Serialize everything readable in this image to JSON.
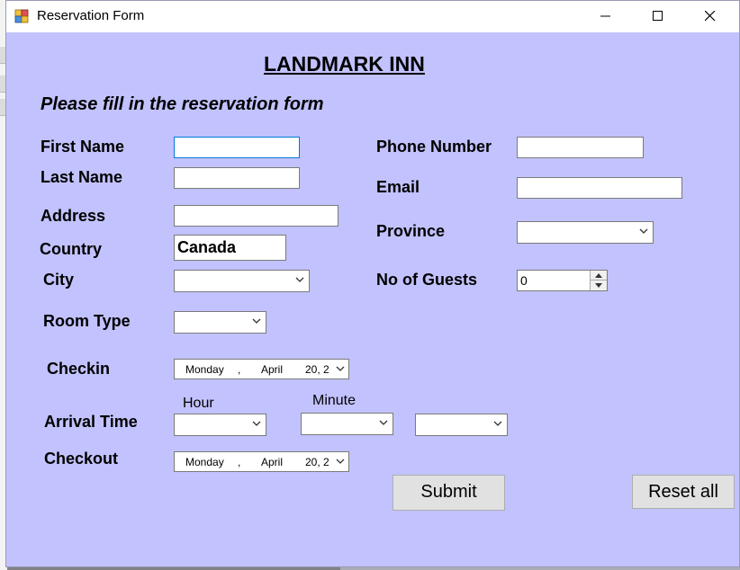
{
  "window": {
    "title": "Reservation Form"
  },
  "form": {
    "heading": "LANDMARK INN",
    "subtitle": "Please fill in the reservation form",
    "first_name": {
      "label": "First Name",
      "value": ""
    },
    "last_name": {
      "label": "Last Name",
      "value": ""
    },
    "address": {
      "label": "Address",
      "value": ""
    },
    "country": {
      "label": "Country",
      "value": "Canada"
    },
    "city": {
      "label": "City",
      "value": ""
    },
    "room_type": {
      "label": "Room Type",
      "value": ""
    },
    "checkin": {
      "label": "Checkin",
      "day": "Monday",
      "sep": ",",
      "month": "April",
      "date": "20, 2"
    },
    "arrival_time": {
      "label": "Arrival Time",
      "hour_label": "Hour",
      "minute_label": "Minute",
      "hour": "",
      "minute": "",
      "period": ""
    },
    "checkout": {
      "label": "Checkout",
      "day": "Monday",
      "sep": ",",
      "month": "April",
      "date": "20, 2"
    },
    "phone": {
      "label": "Phone Number",
      "value": ""
    },
    "email": {
      "label": "Email",
      "value": ""
    },
    "province": {
      "label": "Province",
      "value": ""
    },
    "guests": {
      "label": "No of Guests",
      "value": "0"
    },
    "submit_label": "Submit",
    "reset_label": "Reset all"
  }
}
